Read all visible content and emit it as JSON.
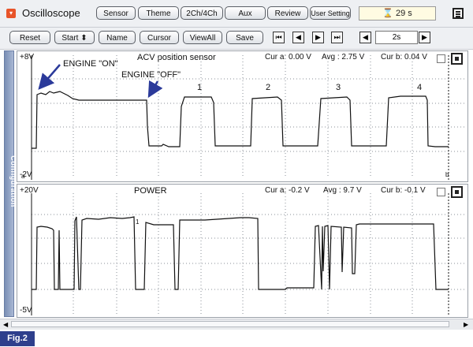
{
  "app": {
    "title": "Oscilloscope",
    "timer": "29 s"
  },
  "top_buttons": [
    "Sensor",
    "Theme",
    "2Ch/4Ch",
    "Aux",
    "Review",
    "User Setting"
  ],
  "toolbar": {
    "reset": "Reset",
    "start": "Start",
    "name": "Name",
    "cursor": "Cursor",
    "viewall": "ViewAll",
    "save": "Save",
    "timebase": "2s"
  },
  "sidebar": {
    "label": "Configuration"
  },
  "channel1": {
    "title": "ACV position sensor",
    "y_top": "+8V",
    "y_bottom": "-2V",
    "cur_a": "Cur a: 0.00 V",
    "avg": "Avg : 2.75 V",
    "cur_b": "Cur b: 0.04 V",
    "marker_a": "a",
    "marker_b": "b",
    "annotations": [
      "ENGINE \"ON\"",
      "ENGINE \"OFF\""
    ],
    "pulse_labels": [
      "1",
      "2",
      "3",
      "4"
    ]
  },
  "channel2": {
    "title": "POWER",
    "y_top": "+20V",
    "y_bottom": "-5V",
    "cur_a": "Cur a: -0.2 V",
    "avg": "Avg : 9.7 V",
    "cur_b": "Cur b: -0.1 V",
    "marker": "1"
  },
  "figure_label": "Fig.2",
  "colors": {
    "arrow": "#2b3a9a",
    "trace": "#111111",
    "fig_bg": "#2e3f8c"
  }
}
